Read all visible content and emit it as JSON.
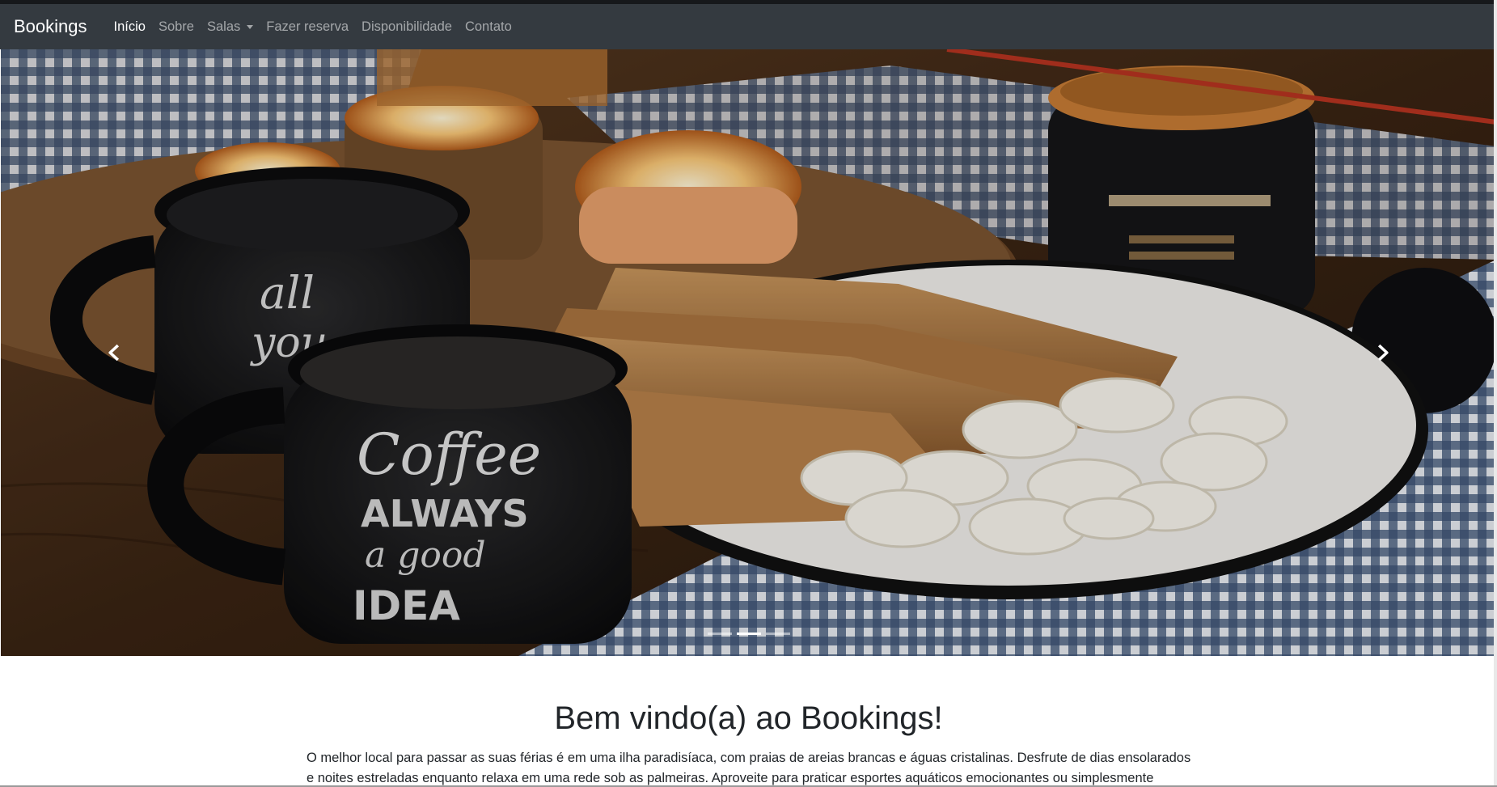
{
  "navbar": {
    "brand": "Bookings",
    "links": [
      {
        "label": "Início",
        "active": true
      },
      {
        "label": "Sobre"
      },
      {
        "label": "Salas"
      },
      {
        "label": "Fazer reserva"
      },
      {
        "label": "Disponibilidade"
      },
      {
        "label": "Contato"
      }
    ]
  },
  "carousel": {
    "slide_count": 3,
    "active_index": 1,
    "prev_icon": "chevron-left-icon",
    "next_icon": "chevron-right-icon"
  },
  "main": {
    "title": "Bem vindo(a) ao Bookings!",
    "paragraph": "O melhor local para passar as suas férias é em uma ilha paradisíaca, com praias de areias brancas e águas cristalinas. Desfrute de dias ensolarados e noites estreladas enquanto relaxa em uma rede sob as palmeiras. Aproveite para praticar esportes aquáticos emocionantes ou simplesmente relaxar em"
  },
  "colors": {
    "navbar_bg": "#343a40",
    "text": "#212529"
  }
}
